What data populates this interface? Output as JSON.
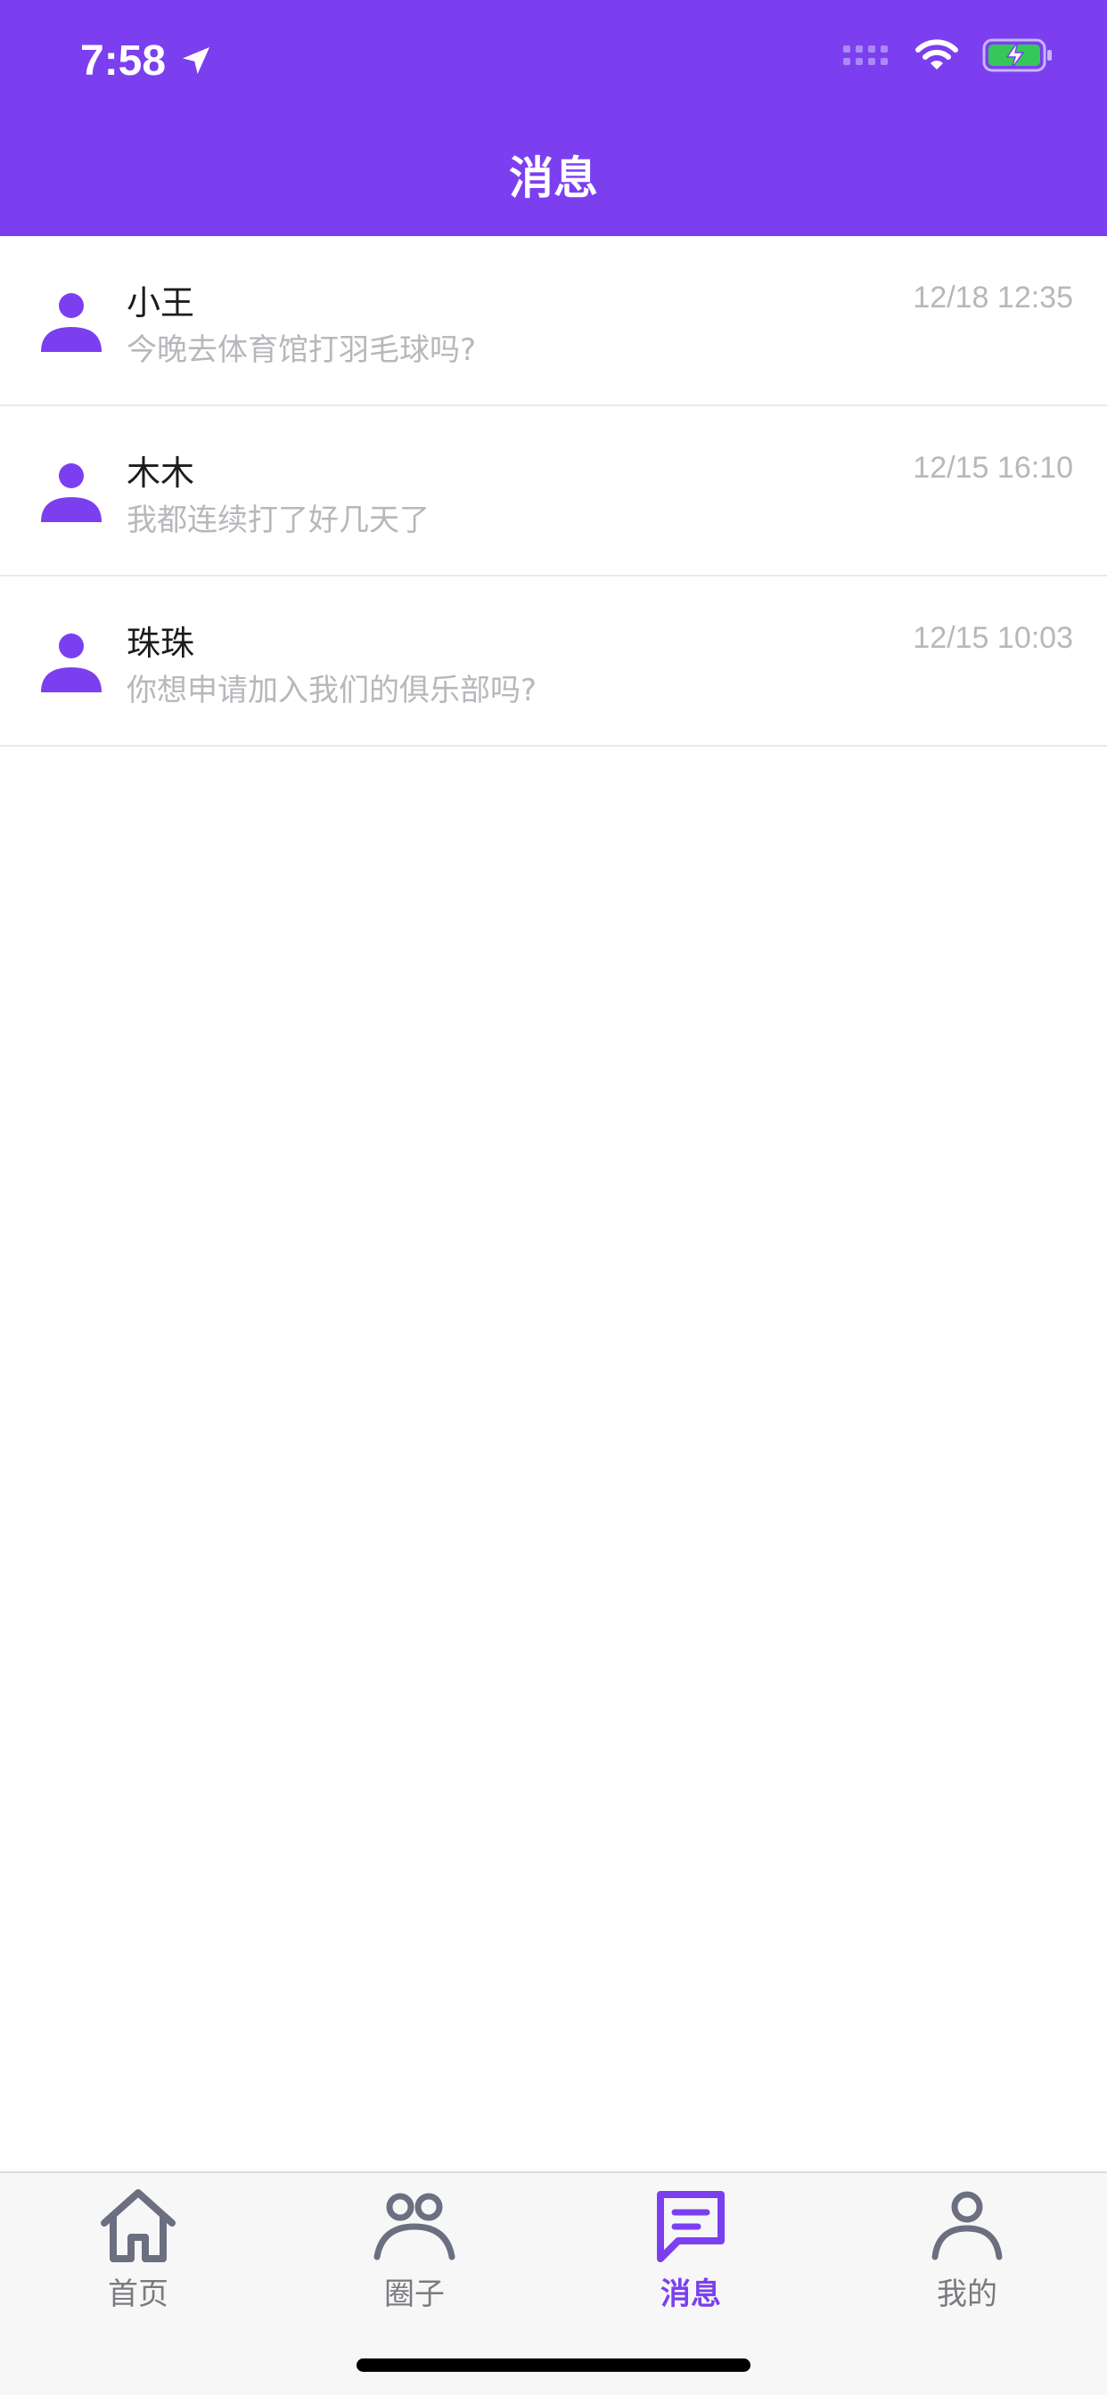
{
  "status_bar": {
    "time": "7:58"
  },
  "header": {
    "title": "消息"
  },
  "messages": [
    {
      "name": "小王",
      "preview": "今晚去体育馆打羽毛球吗?",
      "time": "12/18 12:35"
    },
    {
      "name": "木木",
      "preview": "我都连续打了好几天了",
      "time": "12/15 16:10"
    },
    {
      "name": "珠珠",
      "preview": "你想申请加入我们的俱乐部吗?",
      "time": "12/15 10:03"
    }
  ],
  "tabbar": {
    "tabs": [
      {
        "label": "首页",
        "icon": "home-icon",
        "active": false
      },
      {
        "label": "圈子",
        "icon": "group-icon",
        "active": false
      },
      {
        "label": "消息",
        "icon": "chat-icon",
        "active": true
      },
      {
        "label": "我的",
        "icon": "profile-icon",
        "active": false
      }
    ]
  },
  "colors": {
    "brand": "#7b3ff0",
    "muted_text": "#b7b7bc",
    "inactive_tab": "#6b6f80",
    "battery_fill": "#36c75a"
  }
}
